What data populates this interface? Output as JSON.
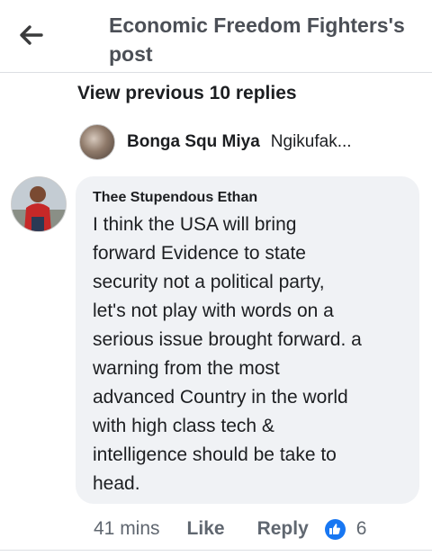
{
  "header": {
    "title": "Economic Freedom Fighters's post",
    "back_icon": "arrow-left-icon"
  },
  "replies": {
    "view_previous_label": "View previous 10 replies",
    "preview": {
      "author": "Bonga Squ Miya",
      "snippet": "Ngikufak..."
    }
  },
  "comment": {
    "author": "Thee Stupendous Ethan",
    "text": "I think the USA will bring\nforward Evidence to state\nsecurity not a political party,\nlet's not play with words on a\nserious issue brought forward. a\nwarning from the most\nadvanced Country in the world\nwith high class tech  &\nintelligence should be take to\nhead.",
    "time": "41 mins",
    "like_label": "Like",
    "reply_label": "Reply",
    "reaction_icon": "thumbs-up-icon",
    "reaction_count": "6"
  },
  "colors": {
    "bubble": "#f0f2f5",
    "like_blue": "#1877f2",
    "muted_text": "#606770"
  }
}
